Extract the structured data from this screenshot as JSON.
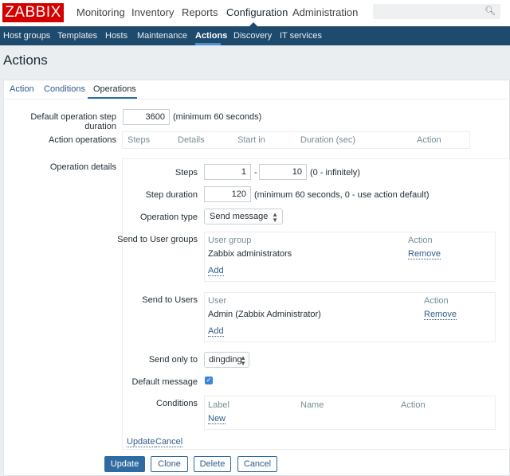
{
  "header": {
    "logo": "ZABBIX",
    "menu": [
      "Monitoring",
      "Inventory",
      "Reports",
      "Configuration",
      "Administration"
    ],
    "active_menu": "Configuration",
    "search_placeholder": ""
  },
  "subnav": {
    "items": [
      "Host groups",
      "Templates",
      "Hosts",
      "Maintenance",
      "Actions",
      "Discovery",
      "IT services"
    ],
    "active": "Actions"
  },
  "page_title": "Actions",
  "tabs": [
    "Action",
    "Conditions",
    "Operations"
  ],
  "active_tab": "Operations",
  "form": {
    "default_step_label": "Default operation step duration",
    "default_step_value": "3600",
    "default_step_hint": "(minimum 60 seconds)",
    "action_ops_label": "Action operations",
    "action_ops_headers": [
      "Steps",
      "Details",
      "Start in",
      "Duration (sec)",
      "Action"
    ],
    "op_details_label": "Operation details",
    "steps_label": "Steps",
    "steps_from": "1",
    "steps_sep": "-",
    "steps_to": "10",
    "steps_hint": "(0 - infinitely)",
    "step_duration_label": "Step duration",
    "step_duration_value": "120",
    "step_duration_hint": "(minimum 60 seconds, 0 - use action default)",
    "op_type_label": "Operation type",
    "op_type_value": "Send message",
    "user_groups": {
      "label": "Send to User groups",
      "headers": [
        "User group",
        "Action"
      ],
      "rows": [
        {
          "name": "Zabbix administrators",
          "action": "Remove"
        }
      ],
      "add": "Add"
    },
    "users": {
      "label": "Send to Users",
      "headers": [
        "User",
        "Action"
      ],
      "rows": [
        {
          "name": "Admin (Zabbix Administrator)",
          "action": "Remove"
        }
      ],
      "add": "Add"
    },
    "send_only_label": "Send only to",
    "send_only_value": "dingding",
    "default_msg_label": "Default message",
    "default_msg_checked": true,
    "conditions": {
      "label": "Conditions",
      "headers": [
        "Label",
        "Name",
        "Action"
      ],
      "new": "New"
    },
    "inline_update": "Update",
    "inline_cancel": "Cancel"
  },
  "buttons": {
    "update": "Update",
    "clone": "Clone",
    "delete": "Delete",
    "cancel": "Cancel"
  },
  "colors": {
    "brand": "#d40000",
    "nav": "#1e4a6d",
    "link": "#2f5d8c",
    "primary": "#2f6ba0"
  }
}
